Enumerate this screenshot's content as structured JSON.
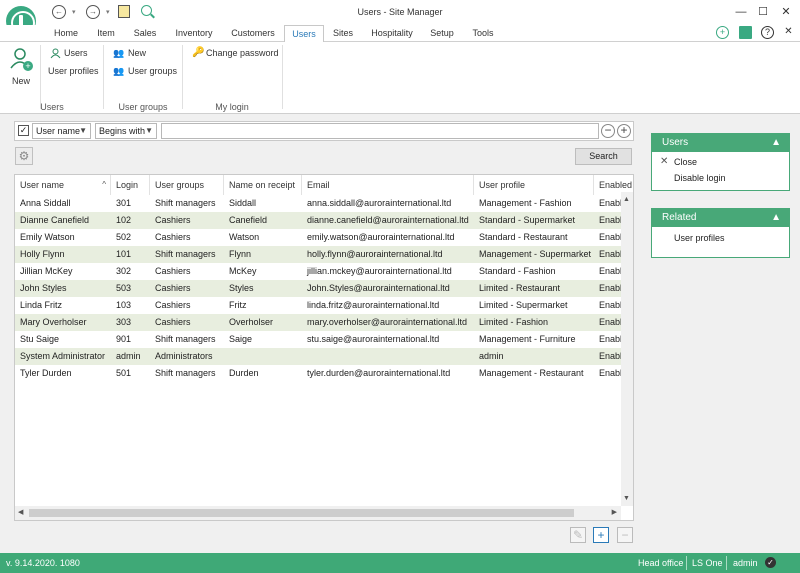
{
  "window": {
    "title": "Users - Site Manager"
  },
  "colors": {
    "accent": "#3fa977",
    "panel_header": "#48a878",
    "row_alt": "#e8eedf",
    "tab_active": "#2a7ab8"
  },
  "quick_access": {
    "back_icon": "back-icon",
    "forward_icon": "forward-icon",
    "notes_icon": "notes-icon",
    "search_icon": "search-icon"
  },
  "tabs": [
    {
      "label": "Home"
    },
    {
      "label": "Item"
    },
    {
      "label": "Sales"
    },
    {
      "label": "Inventory"
    },
    {
      "label": "Customers"
    },
    {
      "label": "Users"
    },
    {
      "label": "Sites"
    },
    {
      "label": "Hospitality"
    },
    {
      "label": "Setup"
    },
    {
      "label": "Tools"
    }
  ],
  "ribbon": {
    "new_label": "New",
    "users_label": "Users",
    "user_profiles_label": "User profiles",
    "group_new_label": "New",
    "user_groups_label": "User groups",
    "change_password_label": "Change password",
    "group_users": "Users",
    "group_user_groups": "User groups",
    "group_my_login": "My login"
  },
  "filter": {
    "field": "User name",
    "operator": "Begins with",
    "value": "",
    "search_label": "Search"
  },
  "grid": {
    "columns": [
      "User name",
      "Login",
      "User groups",
      "Name on receipt",
      "Email",
      "User profile",
      "Enabled"
    ],
    "rows": [
      [
        "Anna Siddall",
        "301",
        "Shift managers",
        "Siddall",
        "anna.siddall@aurorainternational.ltd",
        "Management - Fashion",
        "Enable"
      ],
      [
        "Dianne Canefield",
        "102",
        "Cashiers",
        "Canefield",
        "dianne.canefield@aurorainternational.ltd",
        "Standard - Supermarket",
        "Enable"
      ],
      [
        "Emily Watson",
        "502",
        "Cashiers",
        "Watson",
        "emily.watson@aurorainternational.ltd",
        "Standard - Restaurant",
        "Enable"
      ],
      [
        "Holly Flynn",
        "101",
        "Shift managers",
        "Flynn",
        "holly.flynn@aurorainternational.ltd",
        "Management - Supermarket",
        "Enable"
      ],
      [
        "Jillian McKey",
        "302",
        "Cashiers",
        "McKey",
        "jillian.mckey@aurorainternational.ltd",
        "Standard - Fashion",
        "Enable"
      ],
      [
        "John Styles",
        "503",
        "Cashiers",
        "Styles",
        "John.Styles@aurorainternational.ltd",
        "Limited - Restaurant",
        "Enable"
      ],
      [
        "Linda Fritz",
        "103",
        "Cashiers",
        "Fritz",
        "linda.fritz@aurorainternational.ltd",
        "Limited - Supermarket",
        "Enable"
      ],
      [
        "Mary Overholser",
        "303",
        "Cashiers",
        "Overholser",
        "mary.overholser@aurorainternational.ltd",
        "Limited - Fashion",
        "Enable"
      ],
      [
        "Stu Saige",
        "901",
        "Shift managers",
        "Saige",
        "stu.saige@aurorainternational.ltd",
        "Management - Furniture",
        "Enable"
      ],
      [
        "System Administrator",
        "admin",
        "Administrators",
        "",
        "",
        "admin",
        "Enable"
      ],
      [
        "Tyler Durden",
        "501",
        "Shift managers",
        "Durden",
        "tyler.durden@aurorainternational.ltd",
        "Management - Restaurant",
        "Enable"
      ]
    ]
  },
  "side_panels": {
    "users": {
      "title": "Users",
      "close_label": "Close",
      "disable_label": "Disable login"
    },
    "related": {
      "title": "Related",
      "user_profiles_label": "User profiles"
    }
  },
  "status": {
    "version": "v. 9.14.2020. 1080",
    "site": "Head office",
    "product": "LS One",
    "user": "admin"
  }
}
